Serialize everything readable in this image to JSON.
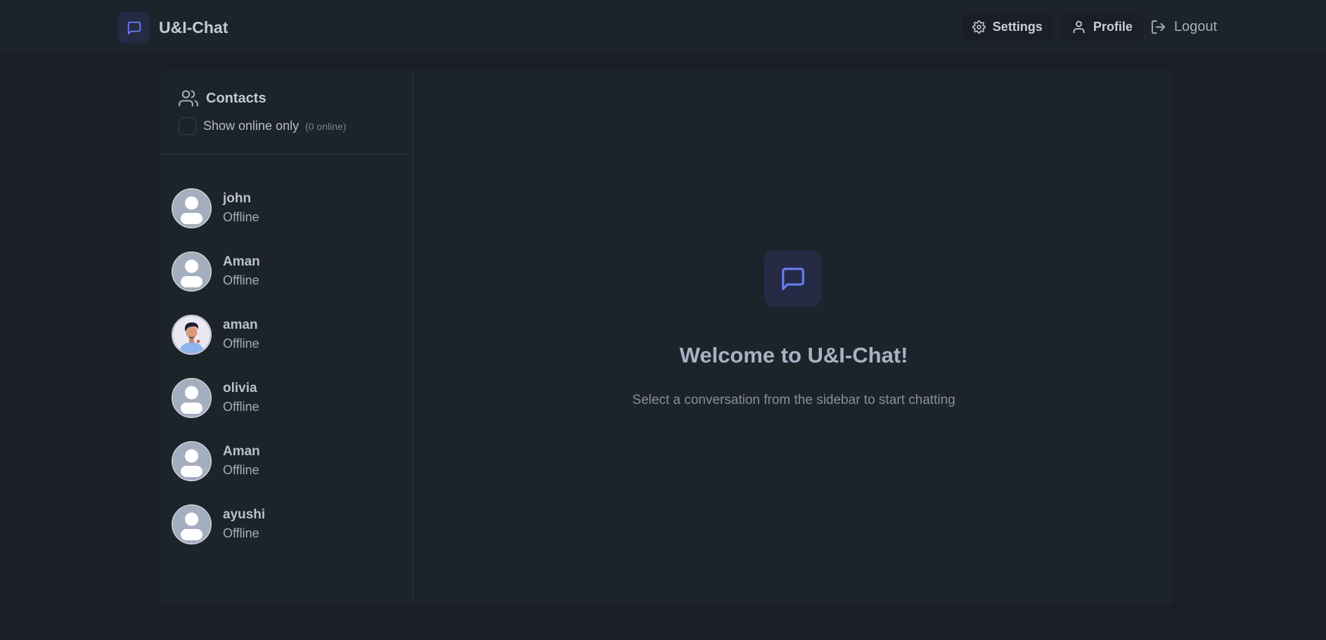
{
  "app": {
    "title": "U&I-Chat",
    "accent": "#6b7cf0"
  },
  "nav": {
    "settings_label": "Settings",
    "profile_label": "Profile",
    "logout_label": "Logout"
  },
  "sidebar": {
    "title": "Contacts",
    "filter_label": "Show online only",
    "online_count": "(0 online)",
    "contacts": [
      {
        "name": "john",
        "status": "Offline",
        "avatar": "default-avatar"
      },
      {
        "name": "Aman",
        "status": "Offline",
        "avatar": "default-avatar"
      },
      {
        "name": "aman",
        "status": "Offline",
        "avatar": "photo-avatar"
      },
      {
        "name": "olivia",
        "status": "Offline",
        "avatar": "default-avatar"
      },
      {
        "name": "Aman",
        "status": "Offline",
        "avatar": "default-avatar"
      },
      {
        "name": "ayushi",
        "status": "Offline",
        "avatar": "default-avatar"
      }
    ]
  },
  "welcome": {
    "title": "Welcome to U&I-Chat!",
    "subtitle": "Select a conversation from the sidebar to start chatting"
  }
}
